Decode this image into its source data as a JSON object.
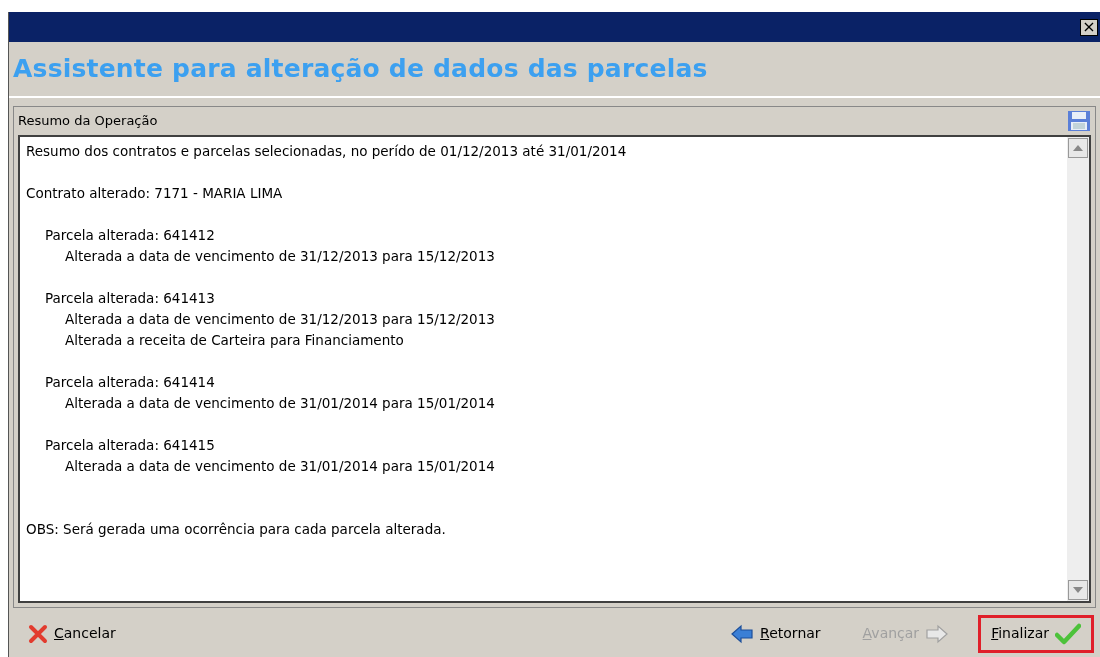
{
  "window": {
    "close": "×"
  },
  "heading": "Assistente para alteração de dados das parcelas",
  "panel": {
    "title": "Resumo da Operação",
    "intro": "Resumo dos contratos e parcelas selecionadas, no perído de 01/12/2013 até 31/01/2014",
    "contract": "Contrato alterado: 7171 - MARIA LIMA",
    "parcels": [
      {
        "text": "Parcela alterada: 641412",
        "changes": [
          "Alterada a data de vencimento de 31/12/2013 para 15/12/2013"
        ]
      },
      {
        "text": "Parcela alterada: 641413",
        "changes": [
          "Alterada a data de vencimento de 31/12/2013 para 15/12/2013",
          "Alterada a receita de Carteira para Financiamento"
        ]
      },
      {
        "text": "Parcela alterada: 641414",
        "changes": [
          "Alterada a data de vencimento de 31/01/2014 para 15/01/2014"
        ]
      },
      {
        "text": "Parcela alterada: 641415",
        "changes": [
          "Alterada a data de vencimento de 31/01/2014 para 15/01/2014"
        ]
      }
    ],
    "note": "OBS: Será gerada uma ocorrência para cada parcela alterada."
  },
  "buttons": [
    {
      "kind": "cancel",
      "label": "Cancelar",
      "disabled": false,
      "highlighted": false
    },
    {
      "kind": "back",
      "label": "Retornar",
      "disabled": false,
      "highlighted": false
    },
    {
      "kind": "next",
      "label": "Avançar",
      "disabled": true,
      "highlighted": false
    },
    {
      "kind": "finish",
      "label": "Finalizar",
      "disabled": false,
      "highlighted": true
    }
  ]
}
